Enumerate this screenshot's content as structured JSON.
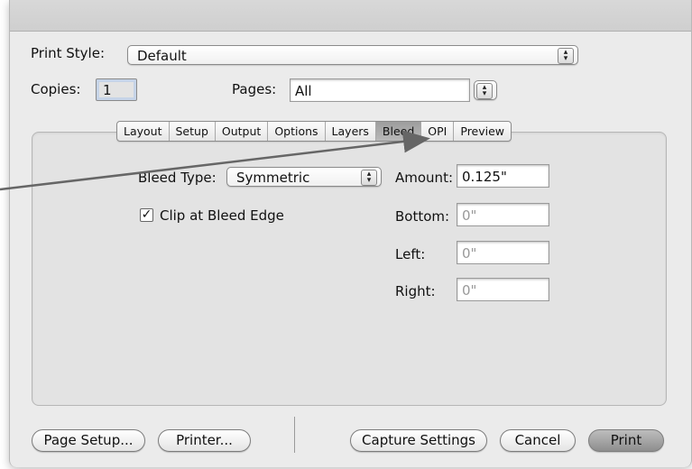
{
  "print_style": {
    "label": "Print Style:",
    "value": "Default"
  },
  "copies": {
    "label": "Copies:",
    "value": "1"
  },
  "pages": {
    "label": "Pages:",
    "value": "All"
  },
  "tabs": [
    "Layout",
    "Setup",
    "Output",
    "Options",
    "Layers",
    "Bleed",
    "OPI",
    "Preview"
  ],
  "active_tab": "Bleed",
  "bleed": {
    "type_label": "Bleed Type:",
    "type_value": "Symmetric",
    "clip_label": "Clip at Bleed Edge",
    "clip_checked": true,
    "amount_label": "Amount:",
    "amount_value": "0.125\"",
    "bottom_label": "Bottom:",
    "bottom_value": "0\"",
    "left_label": "Left:",
    "left_value": "0\"",
    "right_label": "Right:",
    "right_value": "0\""
  },
  "buttons": {
    "page_setup": "Page Setup...",
    "printer": "Printer...",
    "capture_settings": "Capture Settings",
    "cancel": "Cancel",
    "print": "Print"
  },
  "icons": {
    "popup_stepper": "up-down-stepper-icon",
    "checkmark": "checkmark-icon",
    "annotation_arrow": "callout-arrow-icon"
  },
  "colors": {
    "dialog_bg": "#ebebeb",
    "panel_bg": "#e3e3e3",
    "active_tab": "#a9a9a9",
    "arrow": "#666666"
  }
}
